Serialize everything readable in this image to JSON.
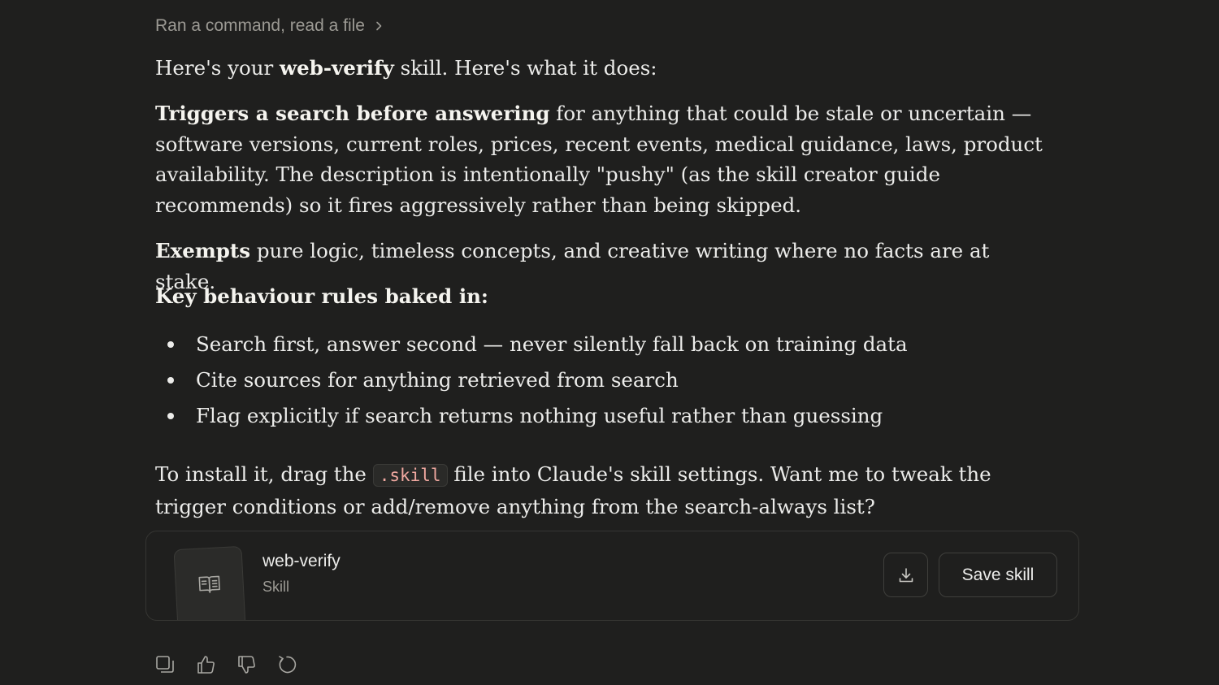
{
  "steps": {
    "label": "Ran a command, read a file"
  },
  "intro": {
    "pre": "Here's your ",
    "bold": "web-verify",
    "post": " skill. Here's what it does:"
  },
  "triggers": {
    "bold": "Triggers a search before answering",
    "text": " for anything that could be stale or uncertain — software versions, current roles, prices, recent events, medical guidance, laws, product availability. The description is intentionally \"pushy\" (as the skill creator guide recommends) so it fires aggressively rather than being skipped."
  },
  "exempts": {
    "bold": "Exempts",
    "text": " pure logic, timeless concepts, and creative writing where no facts are at stake."
  },
  "rules_heading": "Key behaviour rules baked in:",
  "rules": [
    "Search first, answer second — never silently fall back on training data",
    "Cite sources for anything retrieved from search",
    "Flag explicitly if search returns nothing useful rather than guessing"
  ],
  "install": {
    "pre": "To install it, drag the ",
    "code": ".skill",
    "post": " file into Claude's skill settings. Want me to tweak the trigger conditions or add/remove anything from the search-always list?"
  },
  "card": {
    "title": "web-verify",
    "subtitle": "Skill",
    "save_label": "Save skill"
  },
  "icons": {
    "chevron": "chevron-right-icon",
    "book": "book-icon",
    "download": "download-icon",
    "copy": "copy-icon",
    "like": "thumbs-up-icon",
    "dislike": "thumbs-down-icon",
    "retry": "retry-icon"
  },
  "colors": {
    "background": "#1f1f1e",
    "text": "#ececea",
    "muted": "#9c9a94",
    "code": "#f0a8a0"
  }
}
